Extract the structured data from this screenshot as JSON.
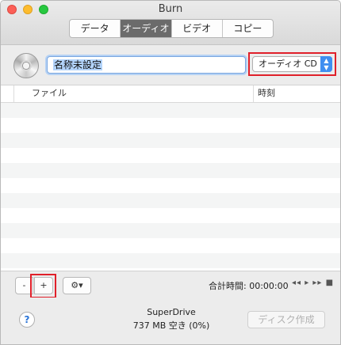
{
  "window": {
    "title": "Burn",
    "tabs": [
      "データ",
      "オーディオ",
      "ビデオ",
      "コピー"
    ],
    "active_tab": 1
  },
  "name_row": {
    "disc_name": "名称未設定",
    "disc_type": "オーディオ CD"
  },
  "table": {
    "columns": [
      "ファイル",
      "時刻"
    ],
    "rows": []
  },
  "controls": {
    "remove_label": "-",
    "add_label": "+",
    "action_icon": "gear-icon",
    "total_time_label": "合計時間:",
    "total_time_value": "00:00:00",
    "playback": "◂◂ ▸ ▸▸ ■"
  },
  "footer": {
    "help_label": "?",
    "drive_name": "SuperDrive",
    "drive_space": "737 MB 空き (0%)",
    "burn_label": "ディスク作成"
  },
  "colors": {
    "highlight_red": "#e0202a",
    "accent_blue": "#3f8ef0",
    "active_tab_bg": "#6b6b6b"
  }
}
